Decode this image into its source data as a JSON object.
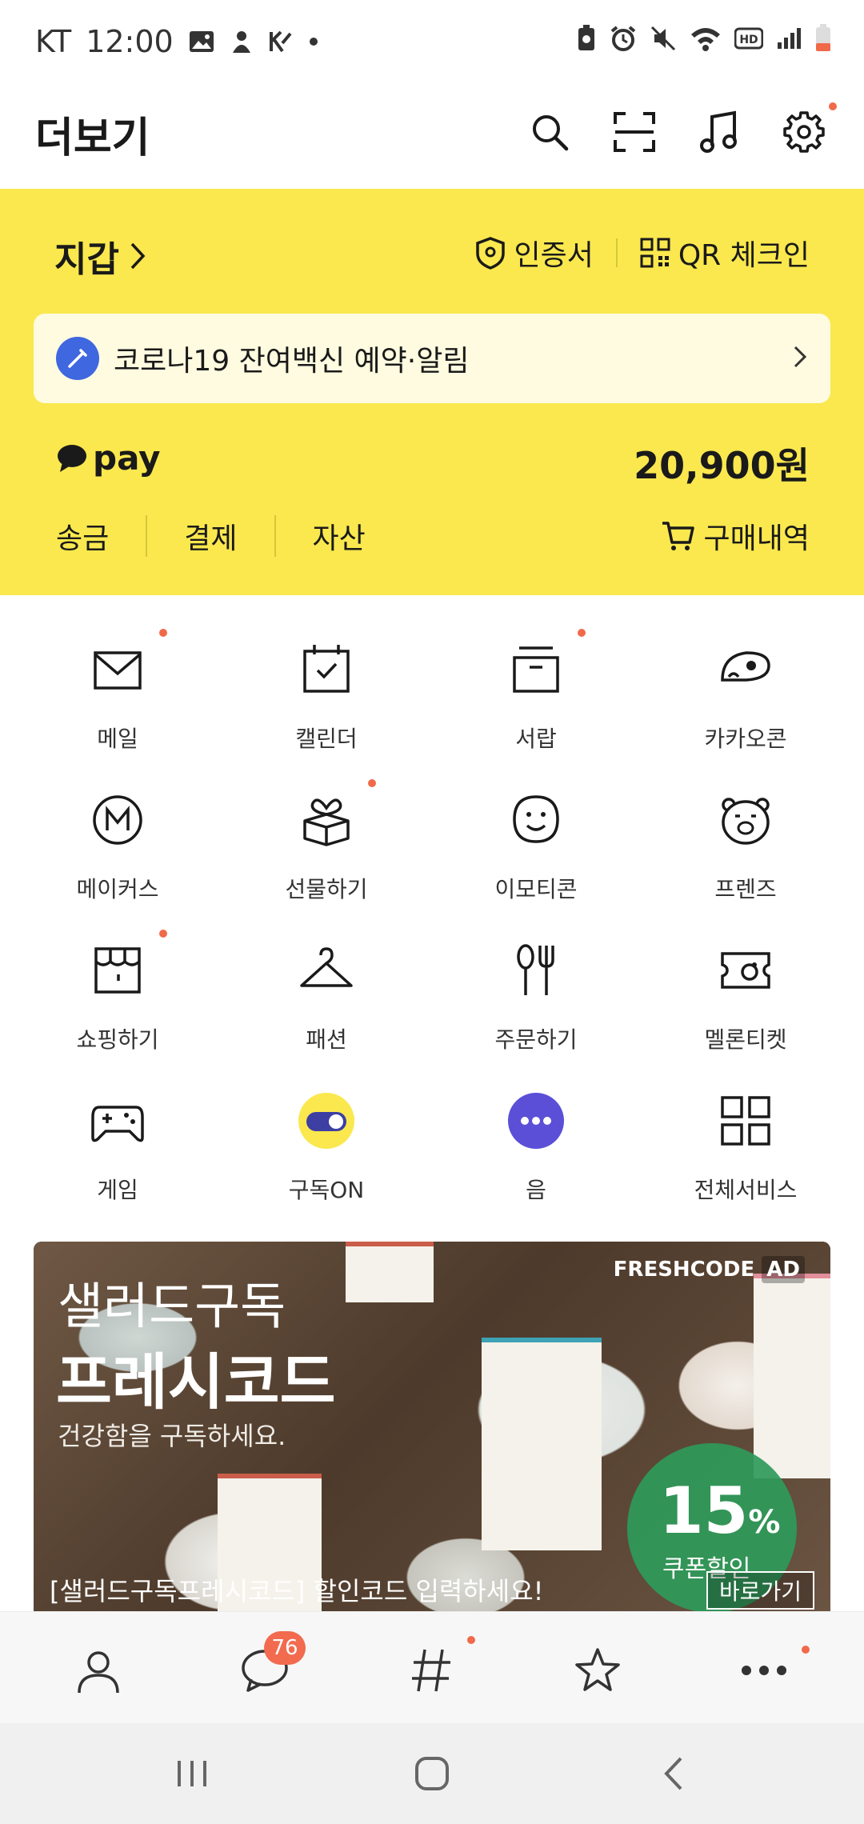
{
  "status_bar": {
    "carrier": "KT",
    "time": "12:00"
  },
  "header": {
    "title": "더보기"
  },
  "wallet": {
    "title": "지갑",
    "cert_label": "인증서",
    "qr_label": "QR 체크인",
    "notice_text": "코로나19 잔여백신 예약·알림",
    "pay_label": "pay",
    "balance": "20,900원",
    "tabs": [
      "송금",
      "결제",
      "자산"
    ],
    "purchase_label": "구매내역"
  },
  "services": [
    {
      "label": "메일",
      "icon": "mail-icon"
    },
    {
      "label": "캘린더",
      "icon": "calendar-icon"
    },
    {
      "label": "서랍",
      "icon": "drawer-icon"
    },
    {
      "label": "카카오콘",
      "icon": "kakaocon-icon"
    },
    {
      "label": "메이커스",
      "icon": "makers-icon"
    },
    {
      "label": "선물하기",
      "icon": "gift-icon"
    },
    {
      "label": "이모티콘",
      "icon": "emoticon-icon"
    },
    {
      "label": "프렌즈",
      "icon": "friends-icon"
    },
    {
      "label": "쇼핑하기",
      "icon": "shopping-icon"
    },
    {
      "label": "패션",
      "icon": "fashion-icon"
    },
    {
      "label": "주문하기",
      "icon": "order-icon"
    },
    {
      "label": "멜론티켓",
      "icon": "melon-ticket-icon"
    },
    {
      "label": "게임",
      "icon": "game-icon"
    },
    {
      "label": "구독ON",
      "icon": "subscribe-on-icon"
    },
    {
      "label": "음",
      "icon": "eum-icon"
    },
    {
      "label": "전체서비스",
      "icon": "all-services-icon"
    }
  ],
  "banner": {
    "line1": "샐러드구독",
    "line2": "프레시코드",
    "line3": "건강함을 구독하세요.",
    "brand": "FRESHCODE",
    "ad": "AD",
    "percent": "15",
    "percent_sign": "%",
    "coupon": "쿠폰할인",
    "bottom_text": "[샐러드구독프레시코드] 할인코드 입력하세요!",
    "cta": "바로가기"
  },
  "bottom_nav": {
    "chat_badge": "76"
  },
  "colors": {
    "wallet_yellow": "#fae84e",
    "accent_dot": "#f06a4a",
    "badge": "#f26b4f"
  }
}
